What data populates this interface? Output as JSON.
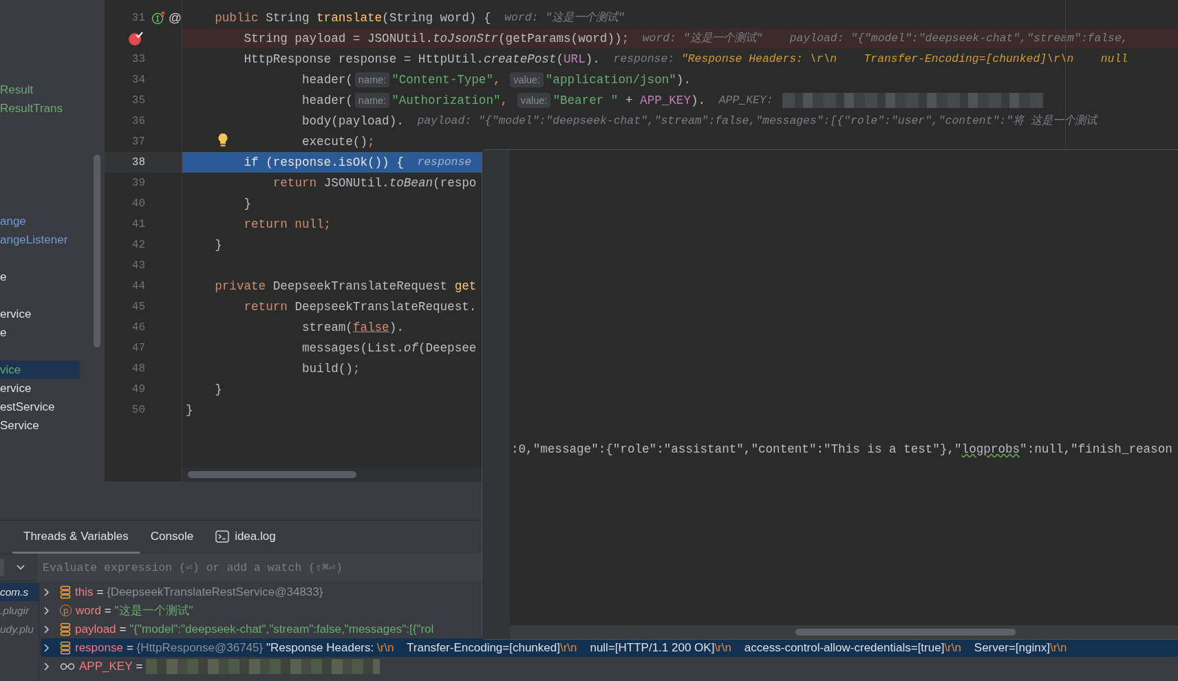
{
  "tree": {
    "groups": [
      {
        "items": [
          {
            "label": "Result",
            "color": "#6aab73",
            "selected": false
          },
          {
            "label": "ResultTrans",
            "color": "#6aab73",
            "selected": false
          }
        ]
      },
      {
        "items": [
          {
            "label": "ange",
            "color": "#6b9bdc",
            "selected": false
          },
          {
            "label": "angeListener",
            "color": "#6b9bdc",
            "selected": false
          }
        ]
      },
      {
        "items": [
          {
            "label": "e",
            "color": "#dfe1e5",
            "selected": false
          }
        ]
      },
      {
        "items": [
          {
            "label": "ervice",
            "color": "#dfe1e5",
            "selected": false
          },
          {
            "label": "e",
            "color": "#dfe1e5",
            "selected": false
          }
        ]
      },
      {
        "items": [
          {
            "label": "vice",
            "color": "#6aab73",
            "selected": true
          },
          {
            "label": "ervice",
            "color": "#dfe1e5",
            "selected": false
          },
          {
            "label": "estService",
            "color": "#dfe1e5",
            "selected": false
          },
          {
            "label": "Service",
            "color": "#dfe1e5",
            "selected": false
          }
        ]
      }
    ]
  },
  "editor": {
    "lines": [
      {
        "number": "31",
        "kind": "declaration",
        "gutter_text": "@",
        "segments": [
          {
            "text": "    public",
            "kind": "kw"
          },
          {
            "text": " String ",
            "kind": "plain"
          },
          {
            "text": "translate",
            "kind": "decl"
          },
          {
            "text": "(String word) {",
            "kind": "plain"
          },
          {
            "text": "  word: \"这是一个测试\"",
            "kind": "hint"
          }
        ]
      },
      {
        "kind": "breakpoint",
        "segments": [
          {
            "text": "        String payload = JSONUtil.",
            "kind": "plain"
          },
          {
            "text": "toJsonStr",
            "kind": "ital"
          },
          {
            "text": "(getParams(word))",
            "kind": "plain"
          },
          {
            "text": ";",
            "kind": "punct"
          },
          {
            "text": "  word: \"这是一个测试\"    payload: \"{\"model\":\"deepseek-chat\",\"stream\":false,",
            "kind": "hint"
          }
        ]
      },
      {
        "number": "33",
        "kind": "code",
        "segments": [
          {
            "text": "        HttpResponse response = HttpUtil.",
            "kind": "plain"
          },
          {
            "text": "createPost",
            "kind": "ital"
          },
          {
            "text": "(",
            "kind": "plain"
          },
          {
            "text": "URL",
            "kind": "field"
          },
          {
            "text": ").",
            "kind": "plain"
          },
          {
            "text": "  response: ",
            "kind": "hint"
          },
          {
            "text": "\"Response Headers: \\r\\n    Transfer-Encoding=[chunked]\\r\\n    null",
            "kind": "hintval"
          }
        ]
      },
      {
        "number": "34",
        "kind": "code",
        "segments": [
          {
            "text": "                header(",
            "kind": "plain"
          },
          {
            "text": "name:",
            "kind": "chip"
          },
          {
            "text": "\"Content-Type\"",
            "kind": "str"
          },
          {
            "text": ", ",
            "kind": "punct"
          },
          {
            "text": "value:",
            "kind": "chip"
          },
          {
            "text": "\"application/json\"",
            "kind": "str"
          },
          {
            "text": ").",
            "kind": "plain"
          }
        ]
      },
      {
        "number": "35",
        "kind": "code",
        "segments": [
          {
            "text": "                header(",
            "kind": "plain"
          },
          {
            "text": "name:",
            "kind": "chip"
          },
          {
            "text": "\"Authorization\"",
            "kind": "str"
          },
          {
            "text": ", ",
            "kind": "punct"
          },
          {
            "text": "value:",
            "kind": "chip"
          },
          {
            "text": "\"Bearer \"",
            "kind": "str"
          },
          {
            "text": " + ",
            "kind": "plain"
          },
          {
            "text": "APP_KEY",
            "kind": "field"
          },
          {
            "text": ").",
            "kind": "plain"
          },
          {
            "text": "  APP_KEY:",
            "kind": "hint"
          },
          {
            "kind": "redacted"
          }
        ]
      },
      {
        "number": "36",
        "kind": "code",
        "segments": [
          {
            "text": "                body(payload).",
            "kind": "plain"
          },
          {
            "text": "  payload: \"{\"model\":\"deepseek-chat\",\"stream\":false,\"messages\":[{\"role\":\"user\",\"content\":\"将 这是一个测试",
            "kind": "hint"
          }
        ]
      },
      {
        "number": "37",
        "kind": "intention",
        "segments": [
          {
            "text": "                execute()",
            "kind": "plain"
          },
          {
            "text": ";",
            "kind": "punct"
          }
        ]
      },
      {
        "number": "38",
        "kind": "execution",
        "segments": [
          {
            "text": "        if",
            "kind": "kw"
          },
          {
            "text": " (response.isOk()) {",
            "kind": "plain"
          },
          {
            "text": "  response",
            "kind": "hint"
          }
        ]
      },
      {
        "number": "39",
        "kind": "code",
        "segments": [
          {
            "text": "            return",
            "kind": "kw"
          },
          {
            "text": " JSONUtil.",
            "kind": "plain"
          },
          {
            "text": "toBean",
            "kind": "ital"
          },
          {
            "text": "(respo",
            "kind": "plain"
          }
        ]
      },
      {
        "number": "40",
        "kind": "code",
        "segments": [
          {
            "text": "        }",
            "kind": "plain"
          }
        ]
      },
      {
        "number": "41",
        "kind": "code",
        "segments": [
          {
            "text": "        return null",
            "kind": "kw"
          },
          {
            "text": ";",
            "kind": "punct"
          }
        ]
      },
      {
        "number": "42",
        "kind": "code",
        "segments": [
          {
            "text": "    }",
            "kind": "plain"
          }
        ]
      },
      {
        "number": "43",
        "kind": "code"
      },
      {
        "number": "44",
        "kind": "code",
        "segments": [
          {
            "text": "    private",
            "kind": "kw"
          },
          {
            "text": " DeepseekTranslateRequest ",
            "kind": "plain"
          },
          {
            "text": "get",
            "kind": "decl"
          }
        ]
      },
      {
        "number": "45",
        "kind": "code",
        "segments": [
          {
            "text": "        return",
            "kind": "kw"
          },
          {
            "text": " DeepseekTranslateRequest.",
            "kind": "plain"
          }
        ]
      },
      {
        "number": "46",
        "kind": "code",
        "segments": [
          {
            "text": "                stream(",
            "kind": "plain"
          },
          {
            "text": "false",
            "kind": "kwlink"
          },
          {
            "text": ").",
            "kind": "plain"
          }
        ]
      },
      {
        "number": "47",
        "kind": "code",
        "segments": [
          {
            "text": "                messages(List.",
            "kind": "plain"
          },
          {
            "text": "of",
            "kind": "ital"
          },
          {
            "text": "(Deepsee",
            "kind": "plain"
          }
        ]
      },
      {
        "number": "48",
        "kind": "code",
        "segments": [
          {
            "text": "                build()",
            "kind": "plain"
          },
          {
            "text": ";",
            "kind": "punct"
          }
        ]
      },
      {
        "number": "49",
        "kind": "code",
        "segments": [
          {
            "text": "    }",
            "kind": "plain"
          }
        ]
      },
      {
        "number": "50",
        "kind": "code",
        "segments": [
          {
            "text": "}",
            "kind": "plain"
          }
        ]
      }
    ]
  },
  "popup": {
    "segments": [
      {
        "text": ":0,\"message\":{\"role\":\"assistant\",\"content\":\"This is a test\"},\"",
        "kind": "plain"
      },
      {
        "text": "logprobs",
        "kind": "typo"
      },
      {
        "text": "\":null,\"finish_reason",
        "kind": "plain"
      }
    ]
  },
  "debugger": {
    "tabs": [
      {
        "label": "Threads & Variables",
        "selected": true,
        "kind": "text"
      },
      {
        "label": "Console",
        "selected": false,
        "kind": "text"
      },
      {
        "label": "idea.log",
        "selected": false,
        "kind": "terminal"
      }
    ],
    "evaluate": {
      "placeholder": "Evaluate expression (⏎) or add a watch (⇧⌘⏎)"
    },
    "frames": [
      {
        "label": "com.s",
        "selected": true
      },
      {
        "label": ".plugir",
        "selected": false
      },
      {
        "label": "udy.plu",
        "selected": false
      }
    ],
    "variables": [
      {
        "name": "this",
        "kind": "field",
        "selected": false,
        "value": [
          {
            "text": "= ",
            "kind": "op"
          },
          {
            "text": "{DeepseekTranslateRestService@34833}",
            "kind": "type"
          }
        ]
      },
      {
        "name": "word",
        "kind": "param",
        "icon_letter": "p",
        "selected": false,
        "value": [
          {
            "text": "= ",
            "kind": "op"
          },
          {
            "text": "\"这是一个测试\"",
            "kind": "str"
          }
        ]
      },
      {
        "name": "payload",
        "kind": "field",
        "selected": false,
        "value": [
          {
            "text": "= ",
            "kind": "op"
          },
          {
            "text": "\"{\"model\":\"deepseek-chat\",\"stream\":false,\"messages\":[{\"rol",
            "kind": "str"
          }
        ]
      },
      {
        "name": "response",
        "kind": "field",
        "selected": true,
        "value": [
          {
            "text": "= ",
            "kind": "op"
          },
          {
            "text": "{HttpResponse@36745}",
            "kind": "type"
          },
          {
            "text": " \"Response Headers: ",
            "kind": "text"
          },
          {
            "text": "\\r\\n",
            "kind": "esc"
          },
          {
            "text": "    Transfer-Encoding=[chunked]",
            "kind": "text"
          },
          {
            "text": "\\r\\n",
            "kind": "esc"
          },
          {
            "text": "    null=[HTTP/1.1 200 OK]",
            "kind": "text"
          },
          {
            "text": "\\r\\n",
            "kind": "esc"
          },
          {
            "text": "    access-control-allow-credentials=[true]",
            "kind": "text"
          },
          {
            "text": "\\r\\n",
            "kind": "esc"
          },
          {
            "text": "    Server=[nginx]",
            "kind": "text"
          },
          {
            "text": "\\r\\n",
            "kind": "esc"
          }
        ]
      },
      {
        "name": "APP_KEY",
        "kind": "watch",
        "selected": false,
        "value": [
          {
            "text": "= ",
            "kind": "op"
          },
          {
            "kind": "redacted"
          }
        ]
      }
    ]
  }
}
